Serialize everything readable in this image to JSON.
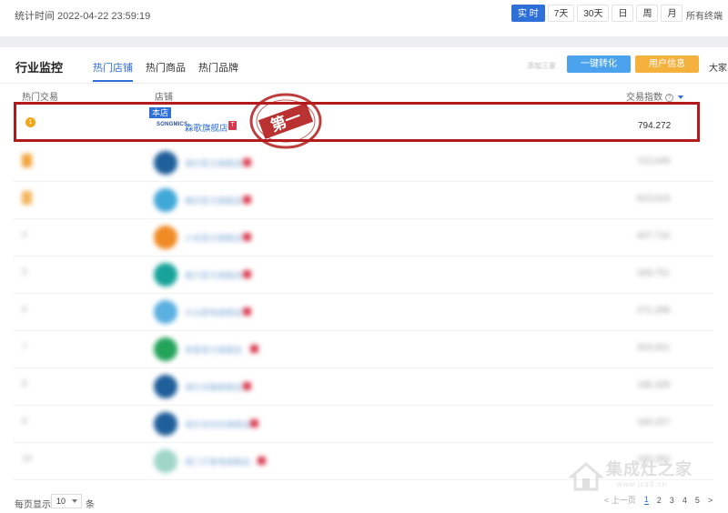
{
  "topbar": {
    "stat_time": "统计时间 2022-04-22 23:59:19",
    "time_tabs": [
      "实 时",
      "7天",
      "30天",
      "日",
      "周",
      "月"
    ],
    "active_time_tab": "实 时",
    "terminal": "所有终端"
  },
  "header": {
    "title": "行业监控",
    "tabs": [
      "热门店铺",
      "热门商品",
      "热门品牌"
    ],
    "active_tab": "热门店铺",
    "compare_label": "添加三家",
    "convert_button": "一键转化",
    "user_info_button": "用户信息",
    "everyone_label": "大家电"
  },
  "table": {
    "columns": {
      "rank": "热门交易",
      "shop": "店铺",
      "value": "交易指数"
    },
    "highlight_row": {
      "badge": "本店",
      "brand_logo_text": "SONGMICS",
      "shop_name": "森歌旗舰店",
      "tmall_mark": "T",
      "value": "794.272"
    },
    "blurred_rows": [
      {
        "rank": "",
        "logo_color": "#1f5f9a",
        "shop": "海尔官方旗舰店",
        "value": "722,649"
      },
      {
        "rank": "",
        "logo_color": "#40a8d8",
        "shop": "美的官方旗舰店",
        "value": "623,618"
      },
      {
        "rank": "4",
        "logo_color": "#f08a24",
        "shop": "小米官方旗舰店",
        "value": "407,716"
      },
      {
        "rank": "5",
        "logo_color": "#18a39a",
        "shop": "格力官方旗舰店",
        "value": "328,751"
      },
      {
        "rank": "6",
        "logo_color": "#5ab0e0",
        "shop": "方太厨电旗舰店",
        "value": "271,288"
      },
      {
        "rank": "7",
        "logo_color": "#24a35a",
        "shop": "老板官方旗舰店",
        "value": "204,501"
      },
      {
        "rank": "8",
        "logo_color": "#1f5f9a",
        "shop": "海尔冰箱旗舰店",
        "value": "196,328"
      },
      {
        "rank": "9",
        "logo_color": "#1f5f9a",
        "shop": "海尔洗衣机旗舰店",
        "value": "190,207"
      },
      {
        "rank": "10",
        "logo_color": "#9fd6c8",
        "shop": "西门子家电旗舰店",
        "value": "150,283"
      }
    ]
  },
  "stamp": {
    "text": "第一"
  },
  "footer": {
    "per_page_label": "每页显示",
    "per_page_value": "10",
    "unit": "条",
    "prev": "< 上一页",
    "pages": [
      "1",
      "2",
      "3",
      "4",
      "5"
    ],
    "current_page": "1",
    "next": ">"
  },
  "watermark": {
    "name": "集成灶之家",
    "url": "www.jcz3.cn"
  },
  "colors": {
    "accent": "#2f6fd8",
    "highlight_border": "#b31b1b",
    "user_button": "#f4b13e",
    "convert_button": "#4aa3ec"
  }
}
